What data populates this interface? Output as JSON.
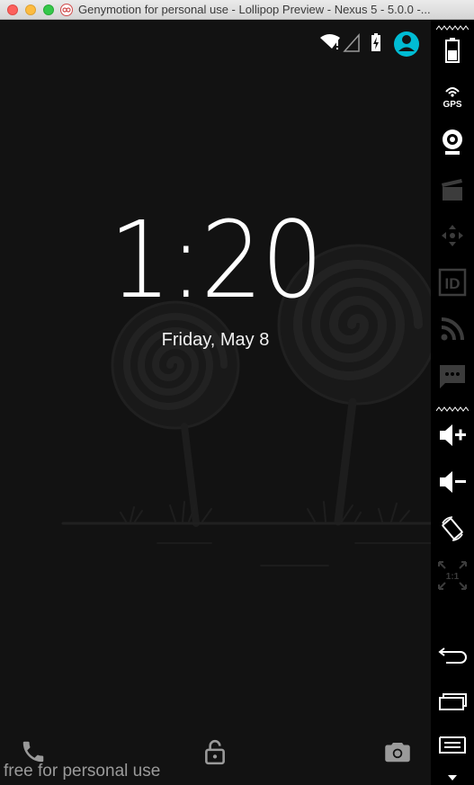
{
  "window": {
    "title": "Genymotion for personal use - Lollipop Preview - Nexus 5 - 5.0.0 -...",
    "buttons": [
      "close",
      "minimize",
      "maximize"
    ]
  },
  "lockscreen": {
    "time": "1:20",
    "date": "Friday, May 8",
    "watermark": "free for personal use",
    "status_icons": [
      "wifi-alert-icon",
      "signal-icon",
      "battery-charging-icon",
      "user-avatar-icon"
    ],
    "shortcuts": [
      "phone-icon",
      "lock-icon",
      "camera-icon"
    ]
  },
  "toolbar": {
    "items": [
      {
        "name": "battery-widget",
        "icon": "battery-icon",
        "label": ""
      },
      {
        "name": "gps-widget",
        "icon": "gps-icon",
        "label": "GPS"
      },
      {
        "name": "webcam-widget",
        "icon": "webcam-icon",
        "label": ""
      },
      {
        "name": "capture-widget",
        "icon": "clapperboard-icon",
        "label": ""
      },
      {
        "name": "remote-control-widget",
        "icon": "dpad-icon",
        "label": ""
      },
      {
        "name": "device-id-widget",
        "icon": "id-icon",
        "label": "ID"
      },
      {
        "name": "network-widget",
        "icon": "rss-icon",
        "label": ""
      },
      {
        "name": "sms-widget",
        "icon": "sms-icon",
        "label": ""
      },
      {
        "name": "volume-up",
        "icon": "volume-up-icon",
        "label": ""
      },
      {
        "name": "volume-down",
        "icon": "volume-down-icon",
        "label": ""
      },
      {
        "name": "rotate",
        "icon": "rotate-icon",
        "label": ""
      },
      {
        "name": "pixel-perfect",
        "icon": "scale-icon",
        "label": "1:1"
      },
      {
        "name": "back",
        "icon": "back-icon",
        "label": ""
      },
      {
        "name": "recent-apps",
        "icon": "recent-apps-icon",
        "label": ""
      },
      {
        "name": "menu",
        "icon": "menu-icon",
        "label": ""
      }
    ]
  },
  "colors": {
    "accent": "#00bcd4",
    "screen_bg": "#121212",
    "toolbar_bg": "#000000",
    "disabled_icon": "#3c3c3c"
  }
}
